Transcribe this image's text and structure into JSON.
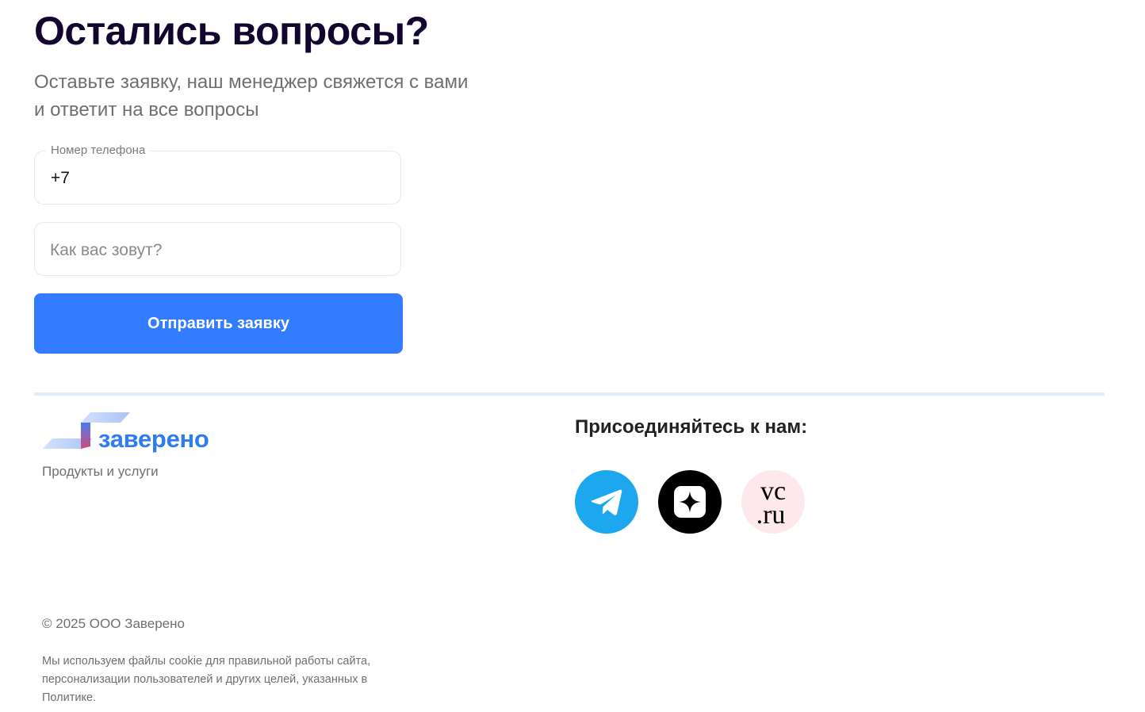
{
  "cta": {
    "title": "Остались вопросы?",
    "subtitle_line1": "Оставьте заявку, наш менеджер свяжется с вами",
    "subtitle_line2": "и ответит на все вопросы"
  },
  "form": {
    "phone": {
      "label": "Номер телефона",
      "value": "+7"
    },
    "name": {
      "placeholder": "Как вас зовут?"
    },
    "submit_label": "Отправить заявку",
    "colors": {
      "button": "#337cff",
      "border": "#e6e9ee"
    }
  },
  "footer": {
    "logo_text": "заверено",
    "products_link": "Продукты и услуги",
    "join_title": "Присоединяйтесь к нам:",
    "social": [
      {
        "icon": "telegram-icon",
        "color": "#1da7ef"
      },
      {
        "icon": "dzen-icon",
        "color": "#000000"
      },
      {
        "icon": "vc-ru-icon",
        "color": "#fde8ec",
        "text_top": "vc",
        "text_bottom": ".ru"
      }
    ],
    "copyright": "© 2025 ООО Заверено",
    "cookie_line1": "Мы используем файлы cookie для правильной работы сайта,",
    "cookie_line2": "персонализации пользователей и других целей, указанных в",
    "cookie_line3": "Политике."
  },
  "colors": {
    "heading": "#12062e",
    "accent": "#2f7bf2",
    "muted_text": "#6f6f6f",
    "divider": "#e3ebf6"
  }
}
